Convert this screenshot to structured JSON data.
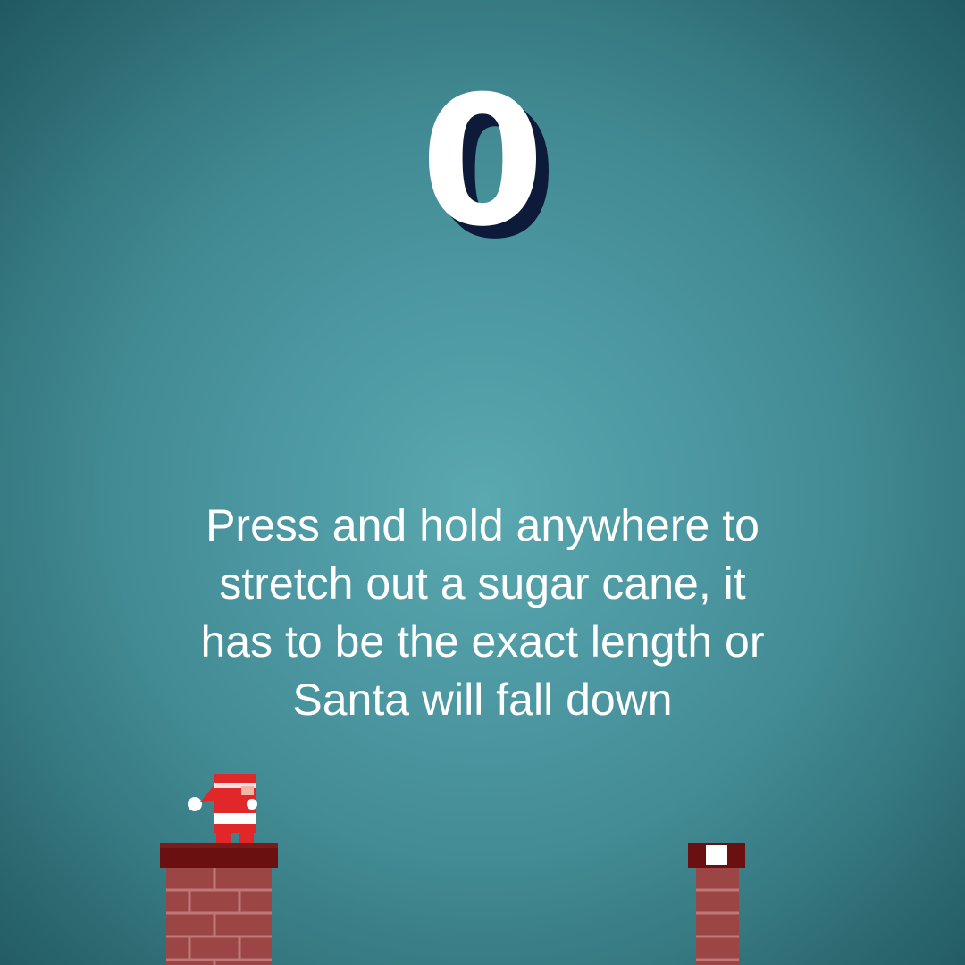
{
  "game": {
    "score": "0",
    "instruction": "Press and hold anywhere to stretch out a sugar cane, it has to be the exact length or Santa will fall down"
  },
  "colors": {
    "background_center": "#5aa8b0",
    "background_edge": "#1a5860",
    "score_shadow": "#0e1a3a",
    "chimney_cap": "#6b1010",
    "chimney_brick": "#9c4545",
    "mortar": "#b86a6a",
    "santa_red": "#e0282a",
    "santa_white": "#ffffff"
  }
}
